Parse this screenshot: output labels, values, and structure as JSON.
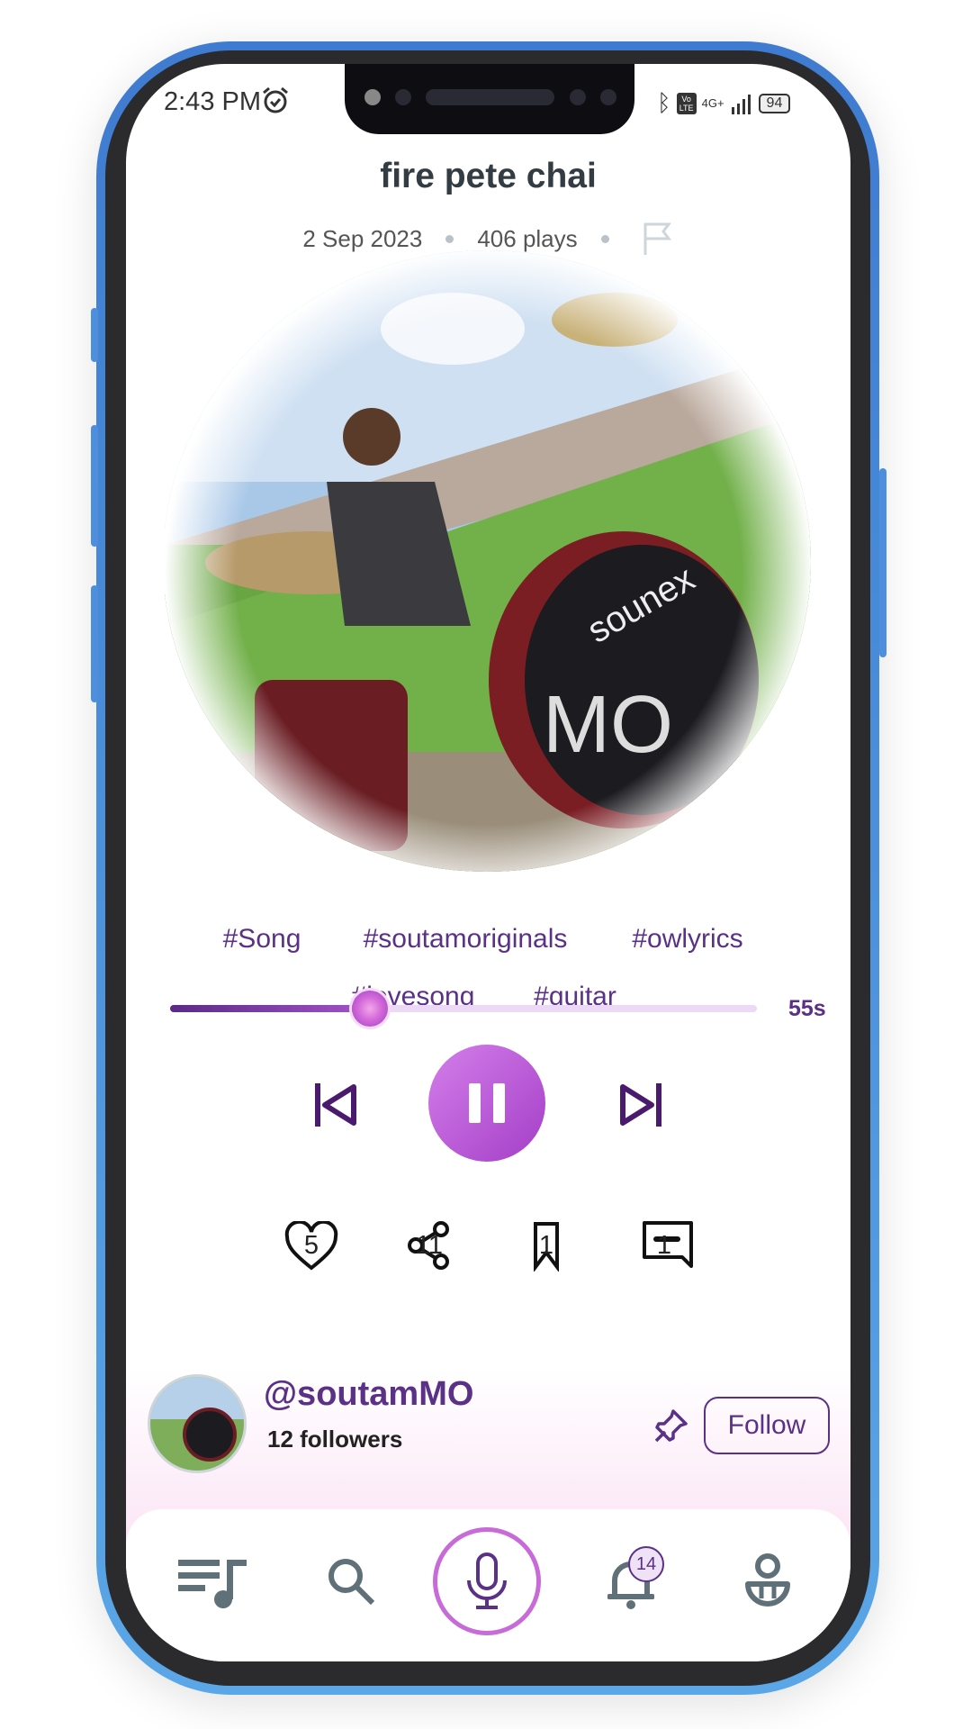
{
  "status_bar": {
    "time": "2:43 PM",
    "network": "4G+",
    "volte": "Vo LTE",
    "battery": "94"
  },
  "track": {
    "title": "fire pete chai",
    "date": "2 Sep 2023",
    "plays": "406 plays"
  },
  "hashtags": [
    "#Song",
    "#soutamoriginals",
    "#owlyrics",
    "#lovesong",
    "#guitar"
  ],
  "player": {
    "progress": 0.34,
    "duration": "55s",
    "state": "playing"
  },
  "actions": [
    {
      "icon": "heart-icon",
      "count": "5"
    },
    {
      "icon": "share-icon",
      "count": "11"
    },
    {
      "icon": "bookmark-icon",
      "count": "1"
    },
    {
      "icon": "comment-icon",
      "count": "1"
    }
  ],
  "artist": {
    "username": "@soutamMO",
    "followers": "12 followers",
    "follow_label": "Follow"
  },
  "nav": {
    "notification_count": "14"
  },
  "colors": {
    "accent": "#5a3187",
    "play": "#b95bd6",
    "frame": "#4a8ad8"
  }
}
